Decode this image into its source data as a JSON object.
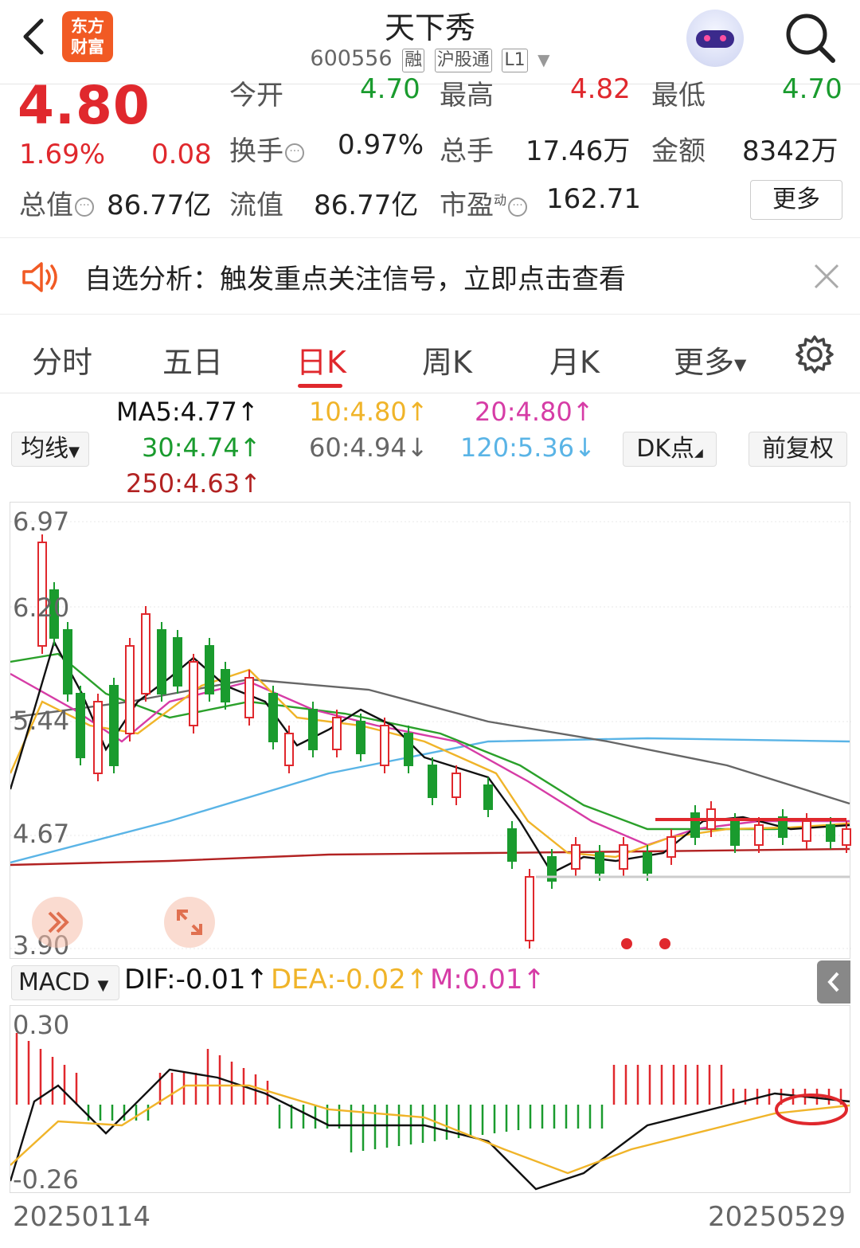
{
  "header": {
    "title": "天下秀",
    "code": "600556",
    "tags": [
      "融",
      "沪股通",
      "L1"
    ],
    "brand_logo_text": [
      "东方",
      "财富"
    ]
  },
  "quote": {
    "price": "4.80",
    "change_pct": "1.69%",
    "change": "0.08",
    "row0": [
      {
        "label": "今开",
        "value": "4.70"
      },
      {
        "label": "最高",
        "value": "4.82"
      },
      {
        "label": "最低",
        "value": "4.70"
      }
    ],
    "turnover_label": "换手",
    "turnover": "0.97%",
    "volume_label": "总手",
    "volume": "17.46万",
    "amount_label": "金额",
    "amount": "8342万",
    "mktcap_label": "总值",
    "mktcap": "86.77亿",
    "float_label": "流值",
    "float_cap": "86.77亿",
    "pe_label": "市盈",
    "pe_sup": "动",
    "pe": "162.71",
    "more_button": "更多"
  },
  "notice": {
    "text": "自选分析：触发重点关注信号，立即点击查看"
  },
  "tabs": {
    "items": [
      "分时",
      "五日",
      "日K",
      "周K",
      "月K",
      "更多"
    ],
    "active_index": 2
  },
  "ma": {
    "selector": "均线",
    "ma5": "MA5:4.77",
    "ma10": "10:4.80",
    "ma20": "20:4.80",
    "ma30": "30:4.74",
    "ma60": "60:4.94",
    "ma120": "120:5.36",
    "ma250": "250:4.63",
    "up_arrow": "↑",
    "down_arrow": "↓",
    "dk_button": "DK点",
    "fq_button": "前复权"
  },
  "colors": {
    "red": "#e0282d",
    "green": "#1a9b2e",
    "ma5": "#111111",
    "ma10": "#f0b429",
    "ma20": "#d63ca6",
    "ma30": "#2aa02a",
    "ma60": "#666666",
    "ma120": "#5ab4e6",
    "ma250": "#b22222"
  },
  "main_chart": {
    "y_labels": [
      "6.97",
      "6.20",
      "5.44",
      "4.67",
      "3.90"
    ]
  },
  "macd": {
    "selector": "MACD",
    "dif": "DIF:-0.01",
    "dea": "DEA:-0.02",
    "m": "M:0.01",
    "y_top": "0.30",
    "y_bottom": "-0.26"
  },
  "dates": {
    "start": "20250114",
    "end": "20250529"
  },
  "chart_data": {
    "type": "candlestick",
    "x_range": [
      "20250114",
      "20250529"
    ],
    "y_ticks": [
      6.97,
      6.2,
      5.44,
      4.67,
      3.9
    ],
    "ylim": [
      3.9,
      6.97
    ],
    "moving_averages": {
      "MA5": 4.77,
      "MA10": 4.8,
      "MA20": 4.8,
      "MA30": 4.74,
      "MA60": 4.94,
      "MA120": 5.36,
      "MA250": 4.63
    },
    "last_close": 4.8,
    "macd": {
      "DIF": -0.01,
      "DEA": -0.02,
      "M": 0.01,
      "ylim": [
        -0.26,
        0.3
      ]
    }
  }
}
